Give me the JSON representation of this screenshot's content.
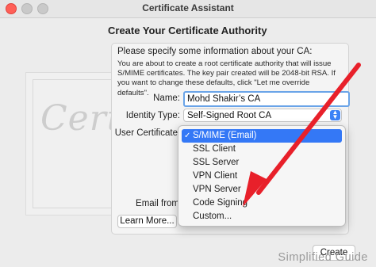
{
  "window": {
    "title": "Certificate Assistant"
  },
  "heading": "Create Your Certificate Authority",
  "art": {
    "word": "Certificate"
  },
  "form": {
    "prompt": "Please specify some information about your CA:",
    "description": "You are about to create a root certificate authority that will issue S/MIME certificates. The key pair created will be 2048-bit RSA. If you want to change these defaults, click \"Let me override defaults\".",
    "name_label": "Name:",
    "name_value": "Mohd Shakir’s CA",
    "identity_type_label": "Identity Type:",
    "identity_type_value": "Self-Signed Root CA",
    "user_certificate_label": "User Certificate",
    "email_from_label": "Email from"
  },
  "dropdown": {
    "selected_index": 0,
    "check_glyph": "✓",
    "items": [
      "S/MIME (Email)",
      "SSL Client",
      "SSL Server",
      "VPN Client",
      "VPN Server",
      "Code Signing",
      "Custom..."
    ]
  },
  "buttons": {
    "learn_more": "Learn More...",
    "create": "Create"
  },
  "watermark": "Simplified Guide",
  "colors": {
    "accent": "#3478f6",
    "annotation_arrow": "#e8202a"
  }
}
